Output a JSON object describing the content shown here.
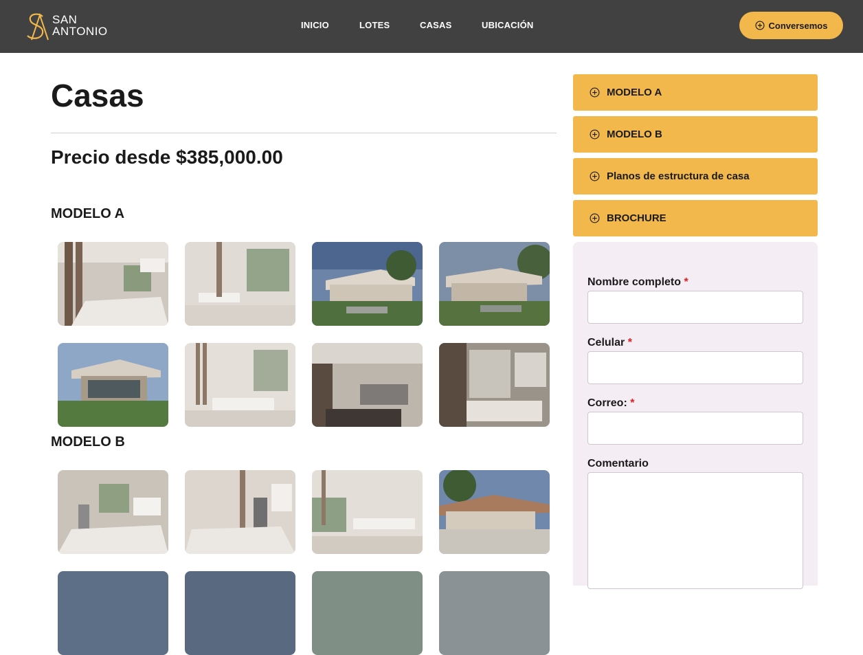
{
  "brand": {
    "logo_line1": "SAN",
    "logo_line2": "ANTONIO",
    "accent": "#f2b84b",
    "header_bg": "#414141"
  },
  "nav": {
    "items": [
      {
        "label": "INICIO"
      },
      {
        "label": "LOTES"
      },
      {
        "label": "CASAS"
      },
      {
        "label": "UBICACIÓN"
      }
    ],
    "cta_label": "Conversemos",
    "cta_icon": "plus-circle-icon"
  },
  "main": {
    "title": "Casas",
    "price": "Precio desde $385,000.00",
    "sections": [
      {
        "title": "MODELO A"
      },
      {
        "title": "MODELO B"
      }
    ]
  },
  "sidebar": {
    "accordion": [
      {
        "label": "MODELO A",
        "icon": "plus-circle-icon"
      },
      {
        "label": "MODELO B",
        "icon": "plus-circle-icon"
      },
      {
        "label": "Planos de estructura de casa",
        "icon": "plus-circle-icon"
      },
      {
        "label": "BROCHURE",
        "icon": "plus-circle-icon"
      }
    ],
    "form": {
      "name_label": "Nombre completo",
      "phone_label": "Celular",
      "email_label": "Correo:",
      "comment_label": "Comentario",
      "required_mark": "*",
      "name_value": "",
      "phone_value": "",
      "email_value": "",
      "comment_value": ""
    }
  }
}
